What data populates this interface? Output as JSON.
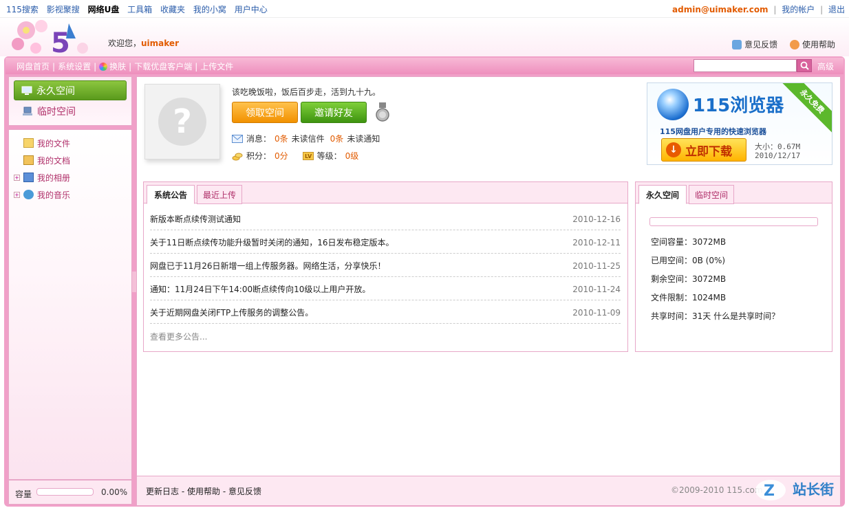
{
  "topnav": {
    "links": [
      "115搜索",
      "影视聚搜",
      "网络U盘",
      "工具箱",
      "收藏夹",
      "我的小窝",
      "用户中心"
    ],
    "email": "admin@uimaker.com",
    "account": "我的帐户",
    "logout": "退出"
  },
  "header": {
    "welcome_prefix": "欢迎您，",
    "username": "uimaker",
    "feedback": "意见反馈",
    "help": "使用帮助"
  },
  "toolbar": {
    "items": [
      "网盘首页",
      "系统设置",
      "换肤",
      "下载优盘客户端",
      "上传文件"
    ],
    "search_placeholder": "",
    "advanced": "高级"
  },
  "sidebar": {
    "permanent": "永久空间",
    "temporary": "临时空间",
    "tree": [
      "我的文件",
      "我的文档",
      "我的相册",
      "我的音乐"
    ],
    "capacity_label": "容量",
    "capacity_value": "0.00%",
    "capacity_fraction": 0
  },
  "profile": {
    "slogan": "该吃晚饭啦，饭后百步走，活到九十九。",
    "claim_button": "领取空间",
    "invite_button": "邀请好友",
    "msg_label": "消息：",
    "unread_mail_count": "0条",
    "unread_mail_text": "未读信件",
    "unread_notice_count": "0条",
    "unread_notice_text": "未读通知",
    "points_label": "积分：",
    "points_value": "0分",
    "level_label": "等级：",
    "level_value": "0级"
  },
  "ad": {
    "title": "115浏览器",
    "ribbon": "永久免费",
    "subtitle": "115网盘用户专用的快速浏览器",
    "download": "立即下载",
    "size": "大小：0.67M",
    "date": "2010/12/17"
  },
  "announcements": {
    "tabs": [
      "系统公告",
      "最近上传"
    ],
    "rows": [
      {
        "title": "新版本断点续传测试通知",
        "date": "2010-12-16"
      },
      {
        "title": "关于11日断点续传功能升级暂时关闭的通知，16日发布稳定版本。",
        "date": "2010-12-11"
      },
      {
        "title": "网盘已于11月26日新增一组上传服务器。网络生活，分享快乐！",
        "date": "2010-11-25"
      },
      {
        "title": "通知：11月24日下午14:00断点续传向10级以上用户开放。",
        "date": "2010-11-24"
      },
      {
        "title": "关于近期网盘关闭FTP上传服务的调整公告。",
        "date": "2010-11-09"
      }
    ],
    "more": "查看更多公告..."
  },
  "space": {
    "tabs": [
      "永久空间",
      "临时空间"
    ],
    "usage_fraction": 0,
    "rows": [
      "空间容量：3072MB",
      "已用空间：0B (0%)",
      "剩余空间：3072MB",
      "文件限制：1024MB",
      "共享时间：31天 什么是共享时间？"
    ]
  },
  "footer": {
    "links": [
      "更新日志",
      "使用帮助",
      "意见反馈"
    ],
    "copyright": "©2009-2010 115.com",
    "watermark": "站长街"
  },
  "colors": {
    "brand_pink": "#f0a0c8",
    "link_blue": "#2a5caa",
    "accent_orange": "#e25b00",
    "green": "#5a9a1c"
  }
}
